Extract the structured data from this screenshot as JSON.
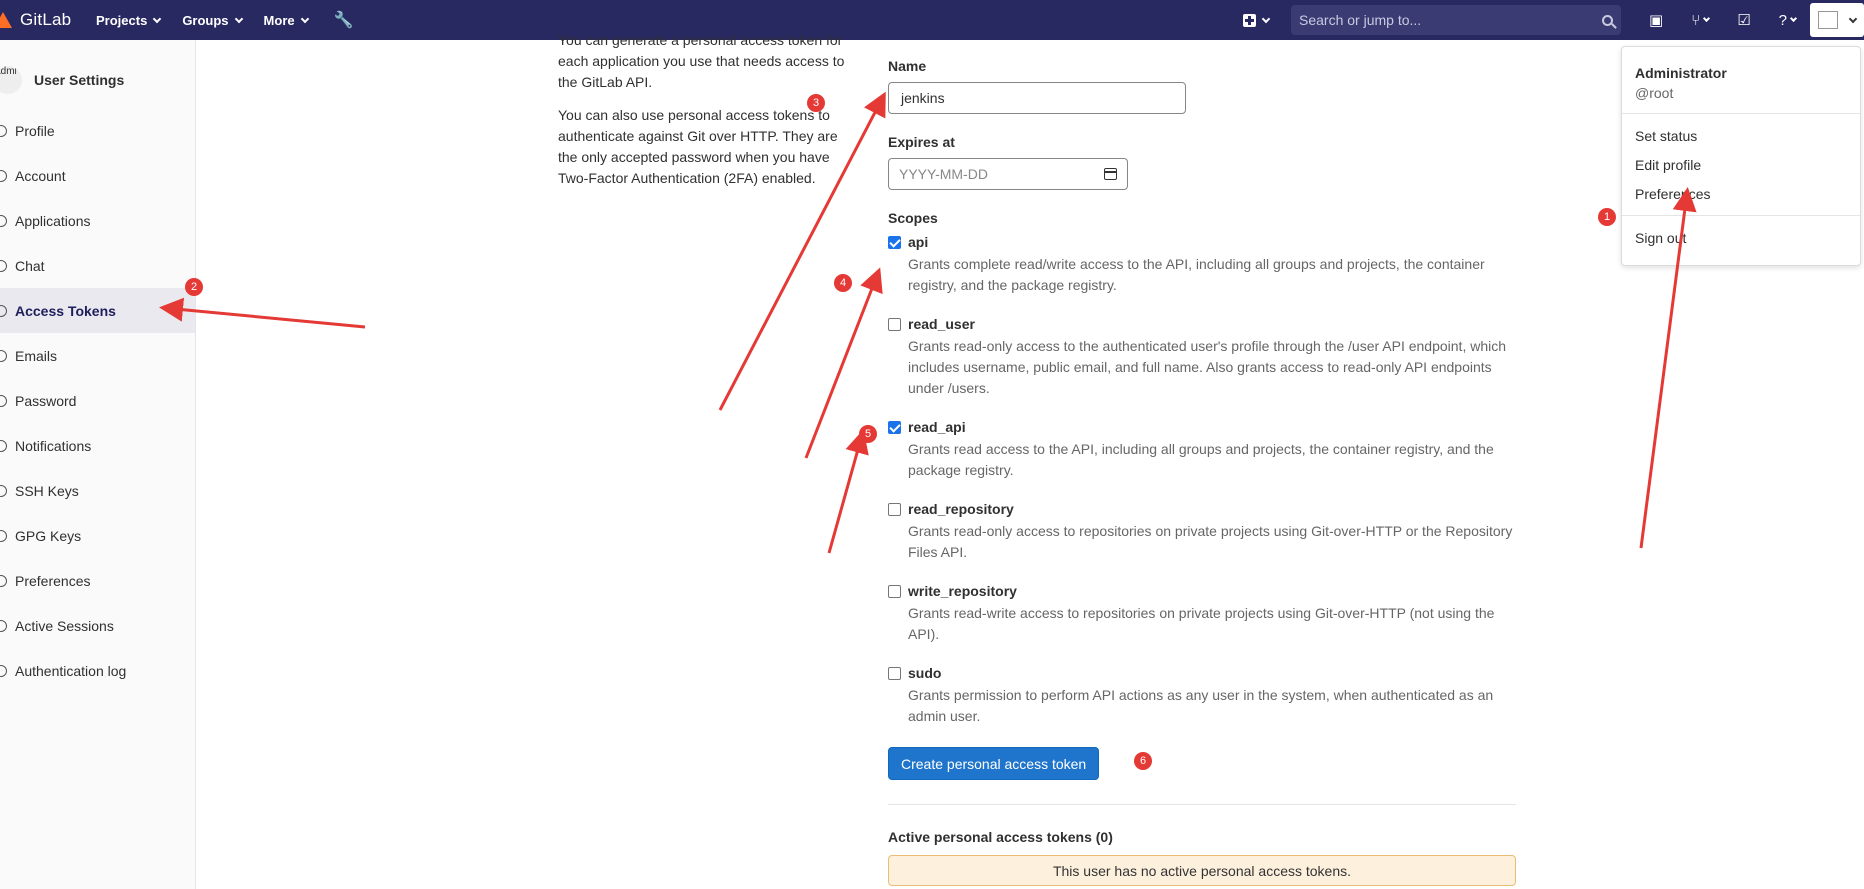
{
  "navbar": {
    "brand": "GitLab",
    "projects": "Projects",
    "groups": "Groups",
    "more": "More",
    "search_placeholder": "Search or jump to..."
  },
  "sidebar": {
    "avatar_text": "Admi",
    "title": "User Settings",
    "items": [
      {
        "label": "Profile"
      },
      {
        "label": "Account"
      },
      {
        "label": "Applications"
      },
      {
        "label": "Chat"
      },
      {
        "label": "Access Tokens"
      },
      {
        "label": "Emails"
      },
      {
        "label": "Password"
      },
      {
        "label": "Notifications"
      },
      {
        "label": "SSH Keys"
      },
      {
        "label": "GPG Keys"
      },
      {
        "label": "Preferences"
      },
      {
        "label": "Active Sessions"
      },
      {
        "label": "Authentication log"
      }
    ]
  },
  "info": {
    "para1_partial": "You can generate a personal access token for each application you use that needs access to the GitLab API.",
    "para2": "You can also use personal access tokens to authenticate against Git over HTTP. They are the only accepted password when you have Two-Factor Authentication (2FA) enabled."
  },
  "form": {
    "name_label": "Name",
    "name_value": "jenkins",
    "expires_label": "Expires at",
    "expires_placeholder": "YYYY-MM-DD",
    "scopes_label": "Scopes",
    "scopes": [
      {
        "name": "api",
        "checked": true,
        "desc": "Grants complete read/write access to the API, including all groups and projects, the container registry, and the package registry."
      },
      {
        "name": "read_user",
        "checked": false,
        "desc": "Grants read-only access to the authenticated user's profile through the /user API endpoint, which includes username, public email, and full name. Also grants access to read-only API endpoints under /users."
      },
      {
        "name": "read_api",
        "checked": true,
        "desc": "Grants read access to the API, including all groups and projects, the container registry, and the package registry."
      },
      {
        "name": "read_repository",
        "checked": false,
        "desc": "Grants read-only access to repositories on private projects using Git-over-HTTP or the Repository Files API."
      },
      {
        "name": "write_repository",
        "checked": false,
        "desc": "Grants read-write access to repositories on private projects using Git-over-HTTP (not using the API)."
      },
      {
        "name": "sudo",
        "checked": false,
        "desc": "Grants permission to perform API actions as any user in the system, when authenticated as an admin user."
      }
    ],
    "submit_label": "Create personal access token",
    "active_title": "Active personal access tokens (0)",
    "empty_message": "This user has no active personal access tokens."
  },
  "dropdown": {
    "name": "Administrator",
    "username": "@root",
    "items": [
      "Set status",
      "Edit profile",
      "Preferences",
      "Sign out"
    ]
  },
  "annotations": [
    "1",
    "2",
    "3",
    "4",
    "5",
    "6"
  ],
  "colors": {
    "navbar": "#292961",
    "primary": "#1f75cb",
    "annotation": "#e53935",
    "warning_bg": "#fdf1dd"
  }
}
